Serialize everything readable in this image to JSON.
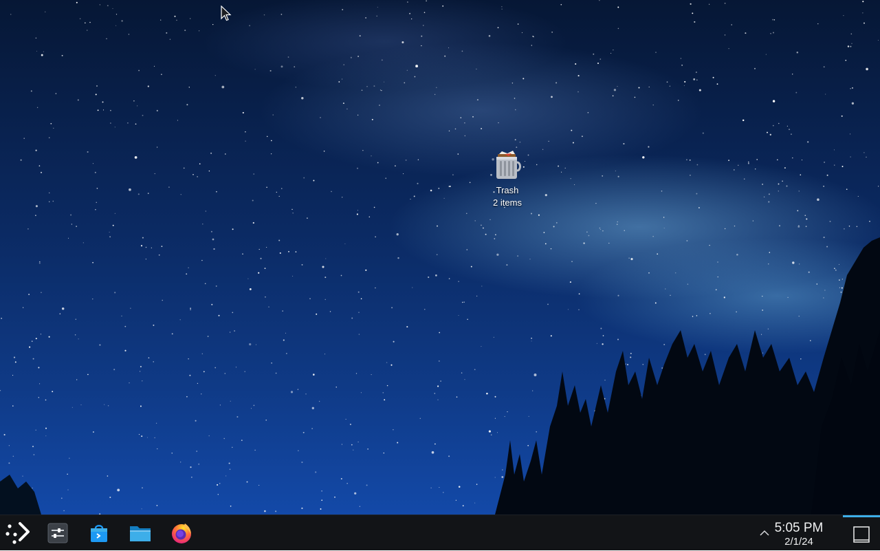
{
  "desktop": {
    "icons": [
      {
        "label": "Trash",
        "sublabel": "2 items",
        "icon": "trash-full-icon"
      }
    ]
  },
  "taskbar": {
    "launcher_icon": "kde-app-launcher-icon",
    "pinned": [
      {
        "icon": "system-settings-icon"
      },
      {
        "icon": "discover-store-icon"
      },
      {
        "icon": "dolphin-folder-icon"
      },
      {
        "icon": "firefox-icon"
      }
    ],
    "clock": {
      "time": "5:05 PM",
      "date": "2/1/24"
    },
    "tray_expand_icon": "chevron-up-icon",
    "show_desktop_icon": "show-desktop-icon"
  },
  "colors": {
    "taskbar_bg": "#121417",
    "accent": "#3daee9",
    "text": "#eff0f1"
  }
}
